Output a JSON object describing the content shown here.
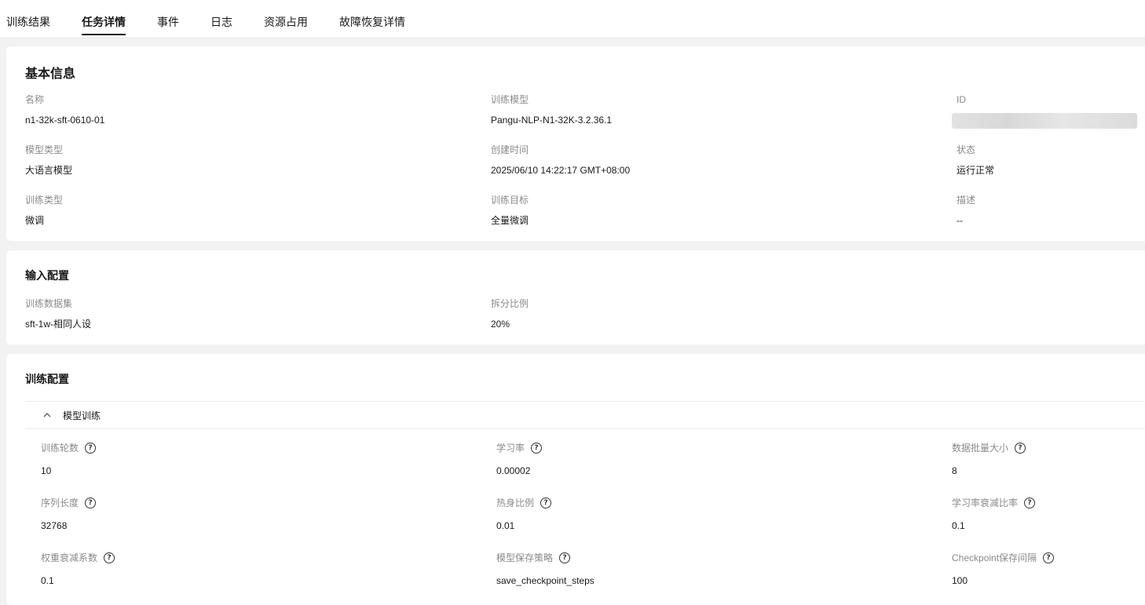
{
  "tabs": [
    {
      "label": "训练结果"
    },
    {
      "label": "任务详情",
      "active": true
    },
    {
      "label": "事件"
    },
    {
      "label": "日志"
    },
    {
      "label": "资源占用"
    },
    {
      "label": "故障恢复详情"
    }
  ],
  "basic_info": {
    "title": "基本信息",
    "fields": [
      {
        "label": "名称",
        "value": "n1-32k-sft-0610-01"
      },
      {
        "label": "训练模型",
        "value": "Pangu-NLP-N1-32K-3.2.36.1"
      },
      {
        "label": "ID",
        "value": ""
      },
      {
        "label": "模型类型",
        "value": "大语言模型"
      },
      {
        "label": "创建时间",
        "value": "2025/06/10 14:22:17 GMT+08:00"
      },
      {
        "label": "状态",
        "value": "运行正常"
      },
      {
        "label": "训练类型",
        "value": "微调"
      },
      {
        "label": "训练目标",
        "value": "全量微调"
      },
      {
        "label": "描述",
        "value": "--"
      }
    ]
  },
  "input_config": {
    "title": "输入配置",
    "fields": [
      {
        "label": "训练数据集",
        "value": "sft-1w-相同人设"
      },
      {
        "label": "拆分比例",
        "value": "20%"
      }
    ]
  },
  "training_config": {
    "title": "训练配置",
    "section_label": "模型训练",
    "params": [
      {
        "label": "训练轮数",
        "value": "10"
      },
      {
        "label": "学习率",
        "value": "0.00002"
      },
      {
        "label": "数据批量大小",
        "value": "8"
      },
      {
        "label": "序列长度",
        "value": "32768"
      },
      {
        "label": "热身比例",
        "value": "0.01"
      },
      {
        "label": "学习率衰减比率",
        "value": "0.1"
      },
      {
        "label": "权重衰减系数",
        "value": "0.1"
      },
      {
        "label": "模型保存策略",
        "value": "save_checkpoint_steps"
      },
      {
        "label": "Checkpoint保存间隔",
        "value": "100"
      }
    ]
  },
  "icons": {
    "help": "question-circle-icon",
    "collapse": "chevron-up-icon"
  }
}
